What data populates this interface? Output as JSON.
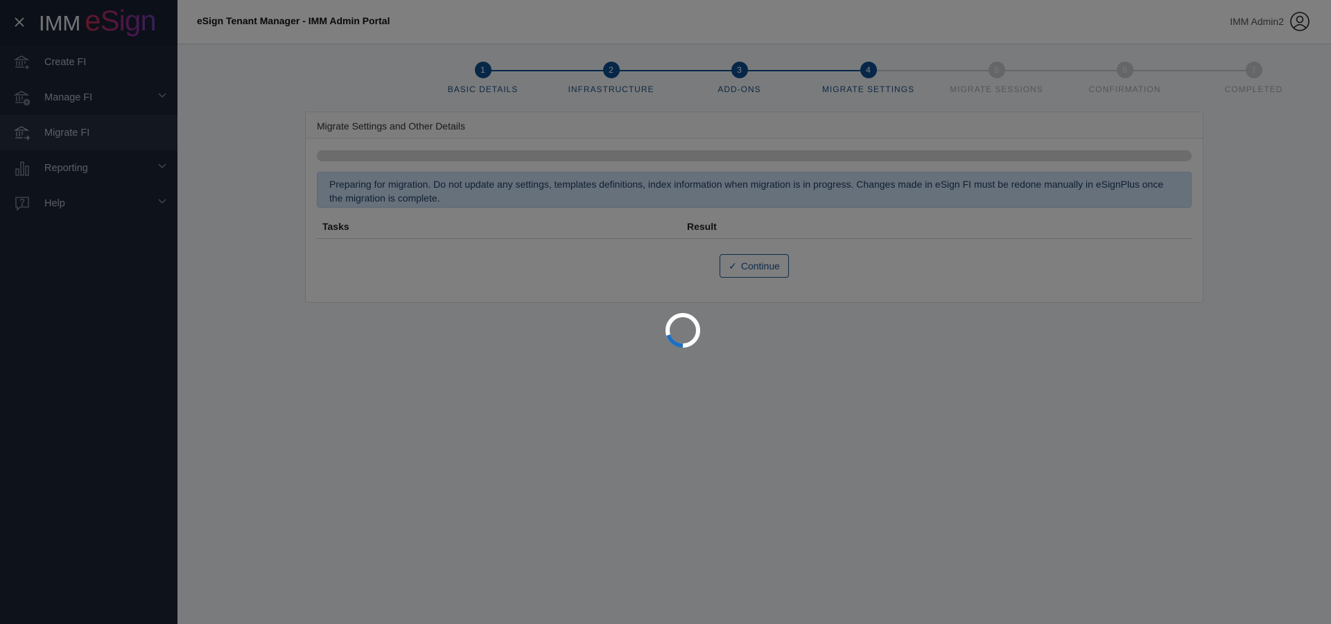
{
  "app": {
    "logo_left": "IMM",
    "logo_right": "eSign",
    "portal_title": "eSign Tenant Manager - IMM Admin Portal",
    "user_name": "IMM Admin2"
  },
  "sidebar": {
    "items": [
      {
        "label": "Create FI",
        "icon": "bank-plus-icon",
        "expandable": false,
        "active": false
      },
      {
        "label": "Manage FI",
        "icon": "bank-gear-icon",
        "expandable": true,
        "active": false
      },
      {
        "label": "Migrate FI",
        "icon": "bank-arrow-icon",
        "expandable": false,
        "active": true
      },
      {
        "label": "Reporting",
        "icon": "bar-chart-icon",
        "expandable": true,
        "active": false
      },
      {
        "label": "Help",
        "icon": "help-chat-icon",
        "expandable": true,
        "active": false
      }
    ]
  },
  "stepper": {
    "current_step": 4,
    "steps": [
      {
        "number": "1",
        "label": "BASIC DETAILS",
        "status": "done"
      },
      {
        "number": "2",
        "label": "INFRASTRUCTURE",
        "status": "done"
      },
      {
        "number": "3",
        "label": "ADD-ONS",
        "status": "done"
      },
      {
        "number": "4",
        "label": "MIGRATE SETTINGS",
        "status": "done"
      },
      {
        "number": "5",
        "label": "MIGRATE SESSIONS",
        "status": "todo"
      },
      {
        "number": "6",
        "label": "CONFIRMATION",
        "status": "todo"
      },
      {
        "number": "7",
        "label": "COMPLETED",
        "status": "todo"
      }
    ]
  },
  "card": {
    "title": "Migrate Settings and Other Details",
    "progress_percent": 0,
    "alert_text": "Preparing for migration. Do not update any settings, templates definitions, index information when migration is in progress. Changes made in eSign FI must be redone manually in eSignPlus once the migration is complete.",
    "table_headers": {
      "tasks": "Tasks",
      "result": "Result"
    },
    "continue_label": "Continue"
  },
  "colors": {
    "sidebar_bg": "#1d2536",
    "step_done": "#0d4f91",
    "step_todo": "#c9ccd1",
    "alert_bg": "#cfe2f7",
    "accent": "#1a5598",
    "spinner_accent": "#1f6fc0"
  },
  "overlay": {
    "loading": true
  }
}
